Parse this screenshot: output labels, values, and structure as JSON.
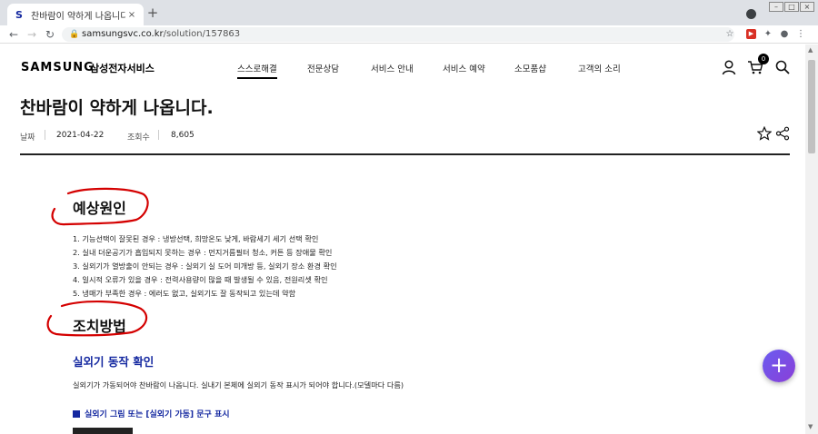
{
  "browser": {
    "tab_title": "찬바람이 약하게 나옵니다.",
    "favicon_letter": "S",
    "tab_close": "×",
    "new_tab": "+",
    "url_host": "samsungsvc.co.kr",
    "url_path": "/solution/157863"
  },
  "header": {
    "logo": "SAMSUNG",
    "logo_sub": "삼성전자서비스",
    "menu": [
      "스스로해결",
      "전문상담",
      "서비스 안내",
      "서비스 예약",
      "소모품샵",
      "고객의 소리"
    ],
    "cart_count": "0"
  },
  "article": {
    "title": "찬바람이 약하게 나옵니다.",
    "date_label": "날짜",
    "date": "2021-04-22",
    "views_label": "조회수",
    "views": "8,605"
  },
  "causes": {
    "heading": "예상원인",
    "items": [
      "1. 기능선택이 잘못된 경우 : 냉방선택, 희망온도 낮게, 바람세기 세기 선택 확인",
      "2. 실내 더운공기가 흡입되지 못하는 경우 : 먼지거름필터 청소, 커튼 등 장애물 확인",
      "3. 실외기가 열방출이 안되는 경우 : 실외기 실 도어 미개방 등, 실외기 장소 환경 확인",
      "4. 일시적 오류가 있을 경우 : 전력사용량이 많을 때 발생될 수 있음, 전원리셋 확인",
      "5. 냉매가 부족한 경우 : 에러도 없고, 실외기도 잘 동작되고 있는데 약함"
    ]
  },
  "solution": {
    "heading": "조치방법",
    "sub_heading": "실외기 동작 확인",
    "body": "실외기가 가동되어야 찬바람이 나옵니다. 실내기 본체에 실외기 동작 표시가 되어야 합니다.(모델마다 다름)",
    "bullet": "실외기 그림 또는 [실외기 가동] 문구 표시"
  },
  "fab_symbol": "+",
  "colors": {
    "brand_blue": "#1428a0",
    "annotation_red": "#d40000",
    "fab_purple": "#7b4ae6"
  }
}
